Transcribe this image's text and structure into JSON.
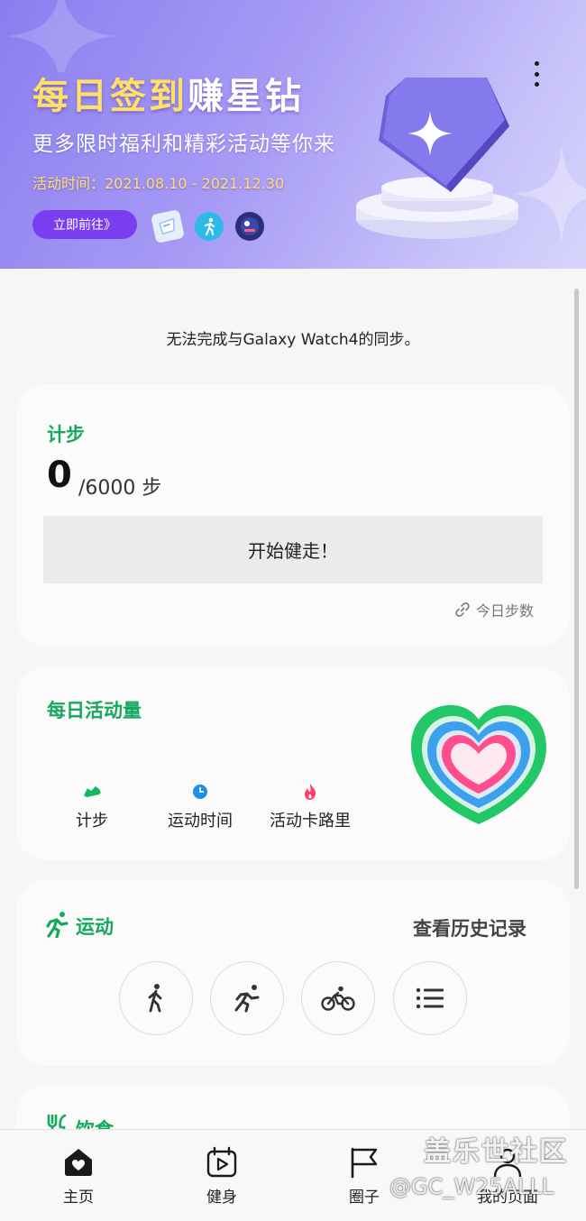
{
  "banner": {
    "title_part1": "每日签到",
    "title_part2": "赚星钻",
    "subtitle": "更多限时福利和精彩活动等你来",
    "date": "活动时间：2021.08.10 - 2021.12.30",
    "button_label": "立即前往》"
  },
  "sync_message": "无法完成与Galaxy Watch4的同步。",
  "steps": {
    "title": "计步",
    "count": "0",
    "goal": "/6000 步",
    "start_button": "开始健走！",
    "today_link": "今日步数"
  },
  "activity": {
    "title": "每日活动量",
    "items": [
      {
        "label": "计步",
        "color": "#16b868"
      },
      {
        "label": "运动时间",
        "color": "#1e8fe8"
      },
      {
        "label": "活动卡路里",
        "color": "#ff3d6e"
      }
    ]
  },
  "exercise": {
    "title": "运动",
    "history_link": "查看历史记录",
    "buttons": [
      "walk-icon",
      "run-icon",
      "bike-icon",
      "list-icon"
    ]
  },
  "food": {
    "title": "饮食"
  },
  "nav": {
    "items": [
      {
        "label": "主页",
        "icon": "home-icon"
      },
      {
        "label": "健身",
        "icon": "play-calendar-icon"
      },
      {
        "label": "圈子",
        "icon": "flag-icon"
      },
      {
        "label": "我的页面",
        "icon": "person-icon"
      }
    ]
  },
  "watermark": {
    "line1": "盖乐世社区",
    "line2": "@GC_W25ALLL"
  },
  "colors": {
    "accent_green": "#16a85f",
    "banner_button": "#7a3ef0"
  }
}
